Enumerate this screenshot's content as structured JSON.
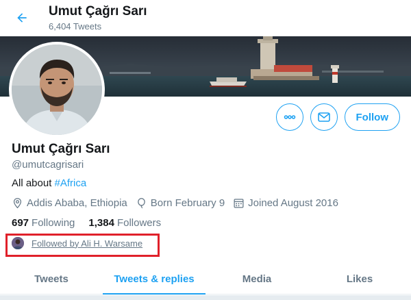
{
  "header": {
    "name": "Umut Çağrı Sarı",
    "tweet_count": "6,404 Tweets"
  },
  "profile": {
    "name": "Umut Çağrı Sarı",
    "handle": "@umutcagrisari",
    "bio_text": "All about ",
    "bio_hashtag": "#Africa",
    "location": "Addis Ababa, Ethiopia",
    "birthday": "Born February 9",
    "joined": "Joined August 2016",
    "following_count": "697",
    "following_label": "Following",
    "followers_count": "1,384",
    "followers_label": "Followers",
    "followed_by": "Followed by Ali H. Warsame"
  },
  "actions": {
    "follow_label": "Follow"
  },
  "tabs": [
    {
      "label": "Tweets"
    },
    {
      "label": "Tweets & replies"
    },
    {
      "label": "Media"
    },
    {
      "label": "Likes"
    }
  ],
  "colors": {
    "accent": "#1da1f2",
    "highlight": "#e0202a"
  }
}
